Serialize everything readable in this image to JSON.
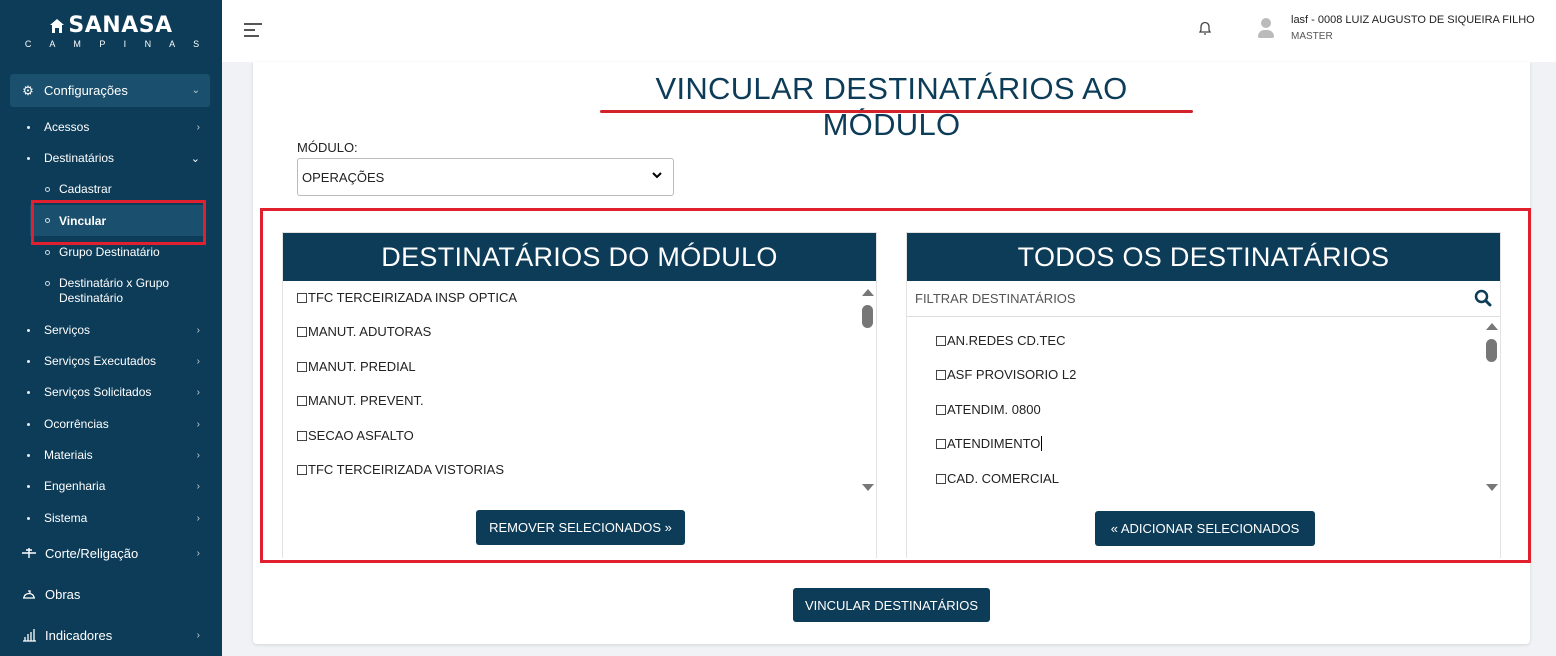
{
  "sidebar": {
    "logo_text": "SANASA",
    "logo_sub": "C A M P I N A S",
    "top_item": "Configurações",
    "items": [
      {
        "label": "Acessos"
      },
      {
        "label": "Destinatários"
      },
      {
        "label": "Serviços"
      },
      {
        "label": "Serviços Executados"
      },
      {
        "label": "Serviços Solicitados"
      },
      {
        "label": "Ocorrências"
      },
      {
        "label": "Materiais"
      },
      {
        "label": "Engenharia"
      },
      {
        "label": "Sistema"
      }
    ],
    "sub_items": [
      {
        "label": "Cadastrar"
      },
      {
        "label": "Vincular"
      },
      {
        "label": "Grupo Destinatário"
      },
      {
        "label": "Destinatário x Grupo Destinatário"
      }
    ],
    "bottom_items": [
      {
        "label": "Corte/Religação",
        "icon": "tap-icon"
      },
      {
        "label": "Obras",
        "icon": "helmet-icon"
      },
      {
        "label": "Indicadores",
        "icon": "chart-icon"
      }
    ]
  },
  "header": {
    "user_name": "lasf - 0008 LUIZ AUGUSTO DE SIQUEIRA FILHO",
    "user_role": "MASTER"
  },
  "main": {
    "title": "VINCULAR DESTINATÁRIOS AO MÓDULO",
    "modulo_label": "MÓDULO:",
    "modulo_value": "OPERAÇÕES",
    "left_panel": {
      "title": "DESTINATÁRIOS DO MÓDULO",
      "items": [
        "TFC TERCEIRIZADA INSP OPTICA",
        "MANUT. ADUTORAS",
        "MANUT. PREDIAL",
        "MANUT. PREVENT.",
        "SECAO ASFALTO",
        "TFC TERCEIRIZADA VISTORIAS"
      ],
      "button": "REMOVER SELECIONADOS »"
    },
    "right_panel": {
      "title": "TODOS OS DESTINATÁRIOS",
      "filter_placeholder": "FILTRAR DESTINATÁRIOS",
      "items": [
        "AN.REDES CD.TEC",
        "ASF PROVISORIO L2",
        "ATENDIM. 0800",
        "ATENDIMENTO",
        "CAD. COMERCIAL"
      ],
      "button": "« ADICIONAR SELECIONADOS"
    },
    "submit_button": "VINCULAR DESTINATÁRIOS"
  },
  "colors": {
    "primary": "#0d3c58",
    "highlight": "#e0202e",
    "underline": "#d2232a"
  }
}
